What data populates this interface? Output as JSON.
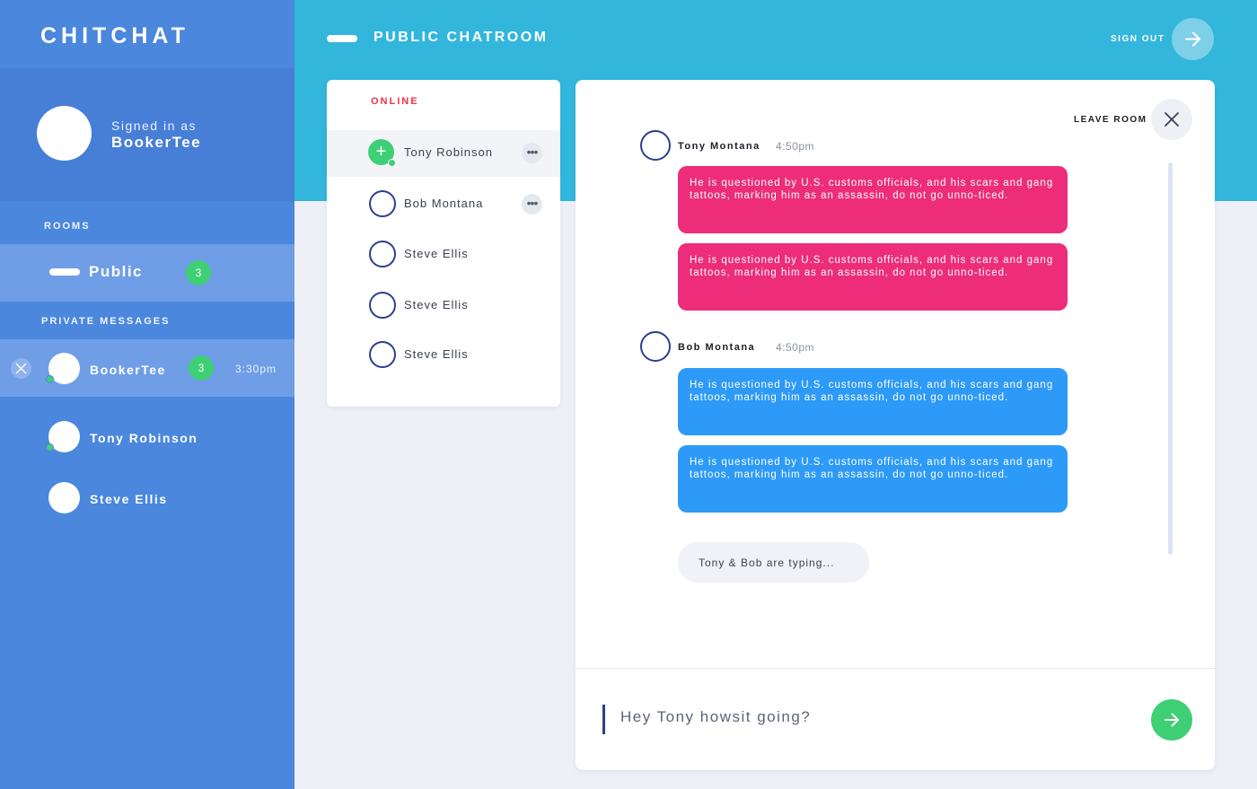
{
  "app": {
    "brand": "CHITCHAT"
  },
  "profile": {
    "signed_label": "Signed in as",
    "username": "BookerTee"
  },
  "rooms": {
    "title": "ROOMS",
    "items": [
      {
        "label": "Public",
        "badge": "3"
      }
    ]
  },
  "private_messages": {
    "title": "PRIVATE MESSAGES",
    "items": [
      {
        "name": "BookerTee",
        "badge": "3",
        "time": "3:30pm"
      },
      {
        "name": "Tony Robinson"
      },
      {
        "name": "Steve Ellis"
      }
    ]
  },
  "header": {
    "title": "PUBLIC CHATROOM",
    "signout_label": "SIGN OUT"
  },
  "online": {
    "title": "ONLINE",
    "users": [
      {
        "name": "Tony Robinson",
        "more": "•••"
      },
      {
        "name": "Bob Montana",
        "more": "•••"
      },
      {
        "name": "Steve Ellis"
      },
      {
        "name": "Steve Ellis"
      },
      {
        "name": "Steve Ellis"
      }
    ]
  },
  "chat": {
    "leave_label": "LEAVE ROOM",
    "groups": [
      {
        "author": "Tony Montana",
        "time": "4:50pm",
        "messages": [
          "He is questioned by U.S. customs officials, and his scars and gang tattoos, marking him as an assassin, do not go unno-ticed.",
          "He is questioned by U.S. customs officials, and his scars and gang tattoos, marking him as an assassin, do not go unno-ticed."
        ]
      },
      {
        "author": "Bob Montana",
        "time": "4:50pm",
        "messages": [
          "He is questioned by U.S. customs officials, and his scars and gang tattoos, marking him as an assassin, do not go unno-ticed.",
          "He is questioned by U.S. customs officials, and his scars and gang tattoos, marking him as an assassin, do not go unno-ticed."
        ]
      }
    ],
    "typing": "Tony & Bob are typing...",
    "composer_value": "Hey Tony howsit going?"
  },
  "colors": {
    "sidebar": "#4a87dd",
    "header": "#33b6dc",
    "bubble_pink": "#ed2d7a",
    "bubble_blue": "#2d9af8",
    "online_green": "#3fcf75",
    "online_title": "#ee3545"
  },
  "icons": {
    "signout": "arrow-right-icon",
    "leave": "close-icon",
    "send": "arrow-right-icon",
    "pm_close": "close-icon",
    "add_user": "plus-icon",
    "more": "more-icon"
  }
}
